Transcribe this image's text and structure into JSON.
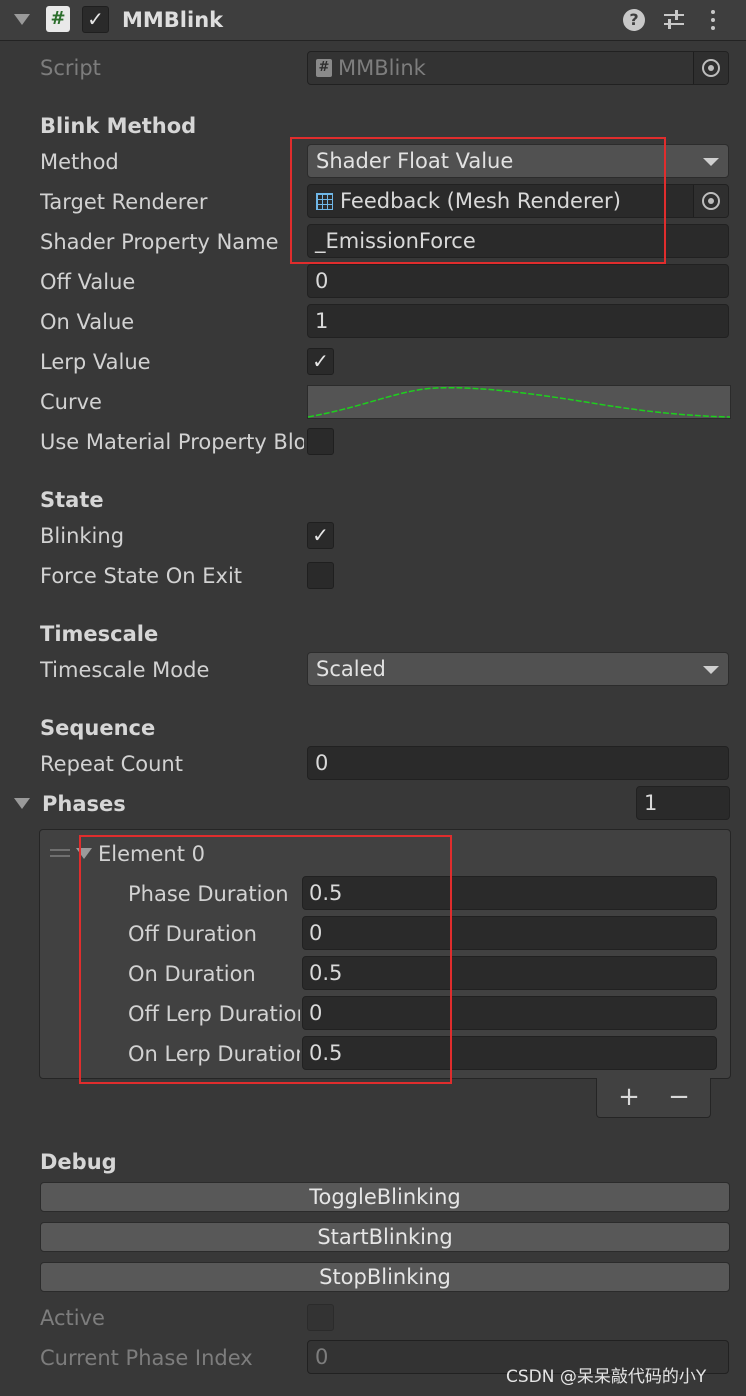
{
  "component": {
    "title": "MMBlink",
    "enabled": "✓"
  },
  "script": {
    "label": "Script",
    "value": "MMBlink"
  },
  "blink_method": {
    "header": "Blink Method",
    "method_label": "Method",
    "method_value": "Shader Float Value",
    "target_renderer_label": "Target Renderer",
    "target_renderer_value": "Feedback (Mesh Renderer)",
    "shader_property_label": "Shader Property Name",
    "shader_property_value": "_EmissionForce",
    "off_value_label": "Off Value",
    "off_value": "0",
    "on_value_label": "On Value",
    "on_value": "1",
    "lerp_value_label": "Lerp Value",
    "lerp_value_checked": "✓",
    "curve_label": "Curve",
    "use_material_label": "Use Material Property Block",
    "use_material_checked": ""
  },
  "state": {
    "header": "State",
    "blinking_label": "Blinking",
    "blinking_checked": "✓",
    "force_state_label": "Force State On Exit",
    "force_state_checked": ""
  },
  "timescale": {
    "header": "Timescale",
    "mode_label": "Timescale Mode",
    "mode_value": "Scaled"
  },
  "sequence": {
    "header": "Sequence",
    "repeat_label": "Repeat Count",
    "repeat_value": "0"
  },
  "phases": {
    "label": "Phases",
    "count": "1",
    "element_label": "Element 0",
    "rows": [
      {
        "label": "Phase Duration",
        "value": "0.5"
      },
      {
        "label": "Off Duration",
        "value": "0"
      },
      {
        "label": "On Duration",
        "value": "0.5"
      },
      {
        "label": "Off Lerp Duration",
        "value": "0"
      },
      {
        "label": "On Lerp Duration",
        "value": "0.5"
      }
    ],
    "add_label": "+",
    "remove_label": "−"
  },
  "debug": {
    "header": "Debug",
    "toggle_label": "ToggleBlinking",
    "start_label": "StartBlinking",
    "stop_label": "StopBlinking",
    "active_label": "Active",
    "current_phase_label": "Current Phase Index",
    "current_phase_value": "0"
  },
  "watermark": "CSDN @呆呆敲代码的小Y",
  "colors": {
    "highlight": "#e02d2d",
    "curve": "#1ecf1e"
  },
  "icons": [
    "foldout-arrow-icon",
    "script-hash-icon",
    "help-icon",
    "preset-sliders-icon",
    "kebab-menu-icon",
    "object-picker-icon",
    "mesh-renderer-icon",
    "drag-handle-icon",
    "dropdown-arrow-icon",
    "checkmark-icon"
  ]
}
